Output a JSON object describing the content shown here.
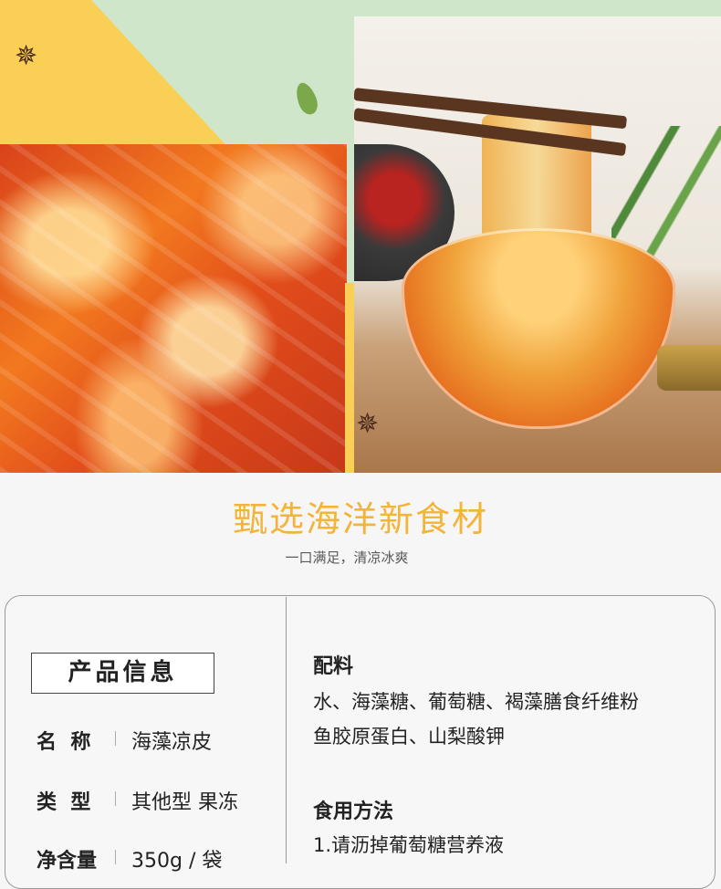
{
  "hero": {
    "colors": {
      "yellow": "#f9cf55",
      "green": "#cfe6cb",
      "jelly_red": "#e24d1a"
    },
    "icons": [
      "star-anise-icon",
      "leaf-icon"
    ]
  },
  "headline": {
    "title": "甄选海洋新食材",
    "subtitle": "一口满足，清凉冰爽"
  },
  "product_info": {
    "heading": "产品信息",
    "rows": [
      {
        "label": "名  称",
        "value": "海藻凉皮"
      },
      {
        "label": "类  型",
        "value": "其他型 果冻"
      },
      {
        "label": "净含量",
        "value": "350g / 袋"
      }
    ]
  },
  "ingredients": {
    "heading": "配料",
    "lines": [
      "水、海藻糖、葡萄糖、褐藻膳食纤维粉",
      "鱼胶原蛋白、山梨酸钾"
    ]
  },
  "usage": {
    "heading": "食用方法",
    "lines": [
      "1.请沥掉葡萄糖营养液"
    ]
  }
}
